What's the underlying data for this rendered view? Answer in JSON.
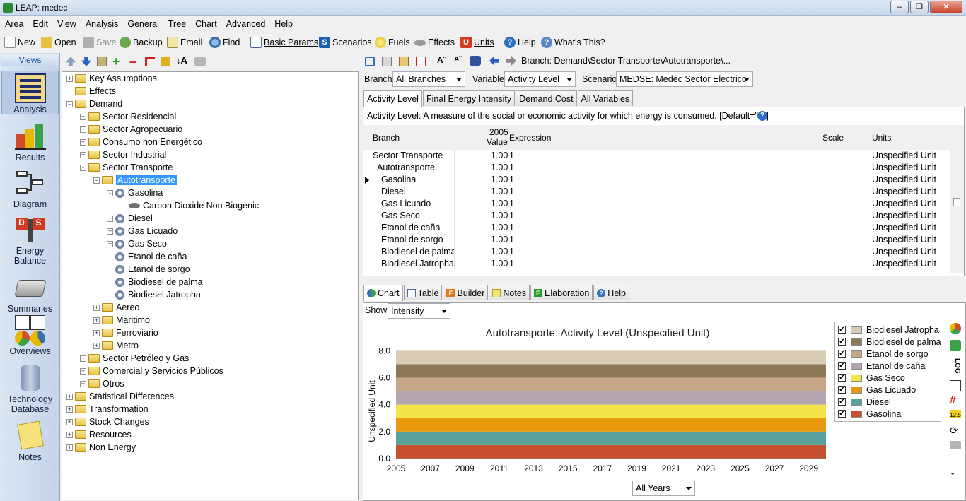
{
  "window": {
    "title": "LEAP: medec"
  },
  "menu": [
    "Area",
    "Edit",
    "View",
    "Analysis",
    "General",
    "Tree",
    "Chart",
    "Advanced",
    "Help"
  ],
  "toolbar": {
    "new": "New",
    "open": "Open",
    "save": "Save",
    "backup": "Backup",
    "email": "Email",
    "find": "Find",
    "basic_params": "Basic Params",
    "scenarios": "Scenarios",
    "fuels": "Fuels",
    "effects": "Effects",
    "units": "Units",
    "help": "Help",
    "whats_this": "What's This?"
  },
  "views": {
    "header": "Views",
    "items": [
      {
        "label": "Analysis",
        "icon": "analysis-icon"
      },
      {
        "label": "Results",
        "icon": "results-icon"
      },
      {
        "label": "Diagram",
        "icon": "diagram-icon"
      },
      {
        "label": "Energy Balance",
        "icon": "energy-balance-icon"
      },
      {
        "label": "Summaries",
        "icon": "summaries-icon"
      },
      {
        "label": "Overviews",
        "icon": "overviews-icon"
      },
      {
        "label": "Technology Database",
        "icon": "technology-database-icon"
      },
      {
        "label": "Notes",
        "icon": "notes-icon"
      }
    ]
  },
  "tree": [
    {
      "label": "Key Assumptions",
      "level": 0,
      "type": "folder",
      "exp": "+"
    },
    {
      "label": "Effects",
      "level": 0,
      "type": "folder",
      "exp": ""
    },
    {
      "label": "Demand",
      "level": 0,
      "type": "folder",
      "exp": "-"
    },
    {
      "label": "Sector Residencial",
      "level": 1,
      "type": "folder",
      "exp": "+"
    },
    {
      "label": "Sector Agropecuario",
      "level": 1,
      "type": "folder",
      "exp": "+"
    },
    {
      "label": "Consumo non Energético",
      "level": 1,
      "type": "folder",
      "exp": "+"
    },
    {
      "label": "Sector Industrial",
      "level": 1,
      "type": "folder",
      "exp": "+"
    },
    {
      "label": "Sector Transporte",
      "level": 1,
      "type": "folder",
      "exp": "-"
    },
    {
      "label": "Autotransporte",
      "level": 2,
      "type": "folder",
      "exp": "-",
      "selected": true
    },
    {
      "label": "Gasolina",
      "level": 3,
      "type": "gear",
      "exp": "-"
    },
    {
      "label": "Carbon Dioxide Non Biogenic",
      "level": 4,
      "type": "leaf",
      "exp": ""
    },
    {
      "label": "Diesel",
      "level": 3,
      "type": "gear",
      "exp": "+"
    },
    {
      "label": "Gas Licuado",
      "level": 3,
      "type": "gear",
      "exp": "+"
    },
    {
      "label": "Gas Seco",
      "level": 3,
      "type": "gear",
      "exp": "+"
    },
    {
      "label": "Etanol de caña",
      "level": 3,
      "type": "gear",
      "exp": ""
    },
    {
      "label": "Etanol de sorgo",
      "level": 3,
      "type": "gear",
      "exp": ""
    },
    {
      "label": "Biodiesel de palma",
      "level": 3,
      "type": "gear",
      "exp": ""
    },
    {
      "label": "Biodiesel Jatropha",
      "level": 3,
      "type": "gear",
      "exp": ""
    },
    {
      "label": "Aereo",
      "level": 2,
      "type": "folder",
      "exp": "+"
    },
    {
      "label": "Maritimo",
      "level": 2,
      "type": "folder",
      "exp": "+"
    },
    {
      "label": "Ferroviario",
      "level": 2,
      "type": "folder",
      "exp": "+"
    },
    {
      "label": "Metro",
      "level": 2,
      "type": "folder",
      "exp": "+"
    },
    {
      "label": "Sector Petróleo y Gas",
      "level": 1,
      "type": "folder",
      "exp": "+"
    },
    {
      "label": "Comercial y Servicios Públicos",
      "level": 1,
      "type": "folder",
      "exp": "+"
    },
    {
      "label": "Otros",
      "level": 1,
      "type": "folder",
      "exp": "+"
    },
    {
      "label": "Statistical Differences",
      "level": 0,
      "type": "folder",
      "exp": "+"
    },
    {
      "label": "Transformation",
      "level": 0,
      "type": "folder",
      "exp": "+"
    },
    {
      "label": "Stock Changes",
      "level": 0,
      "type": "folder",
      "exp": "+"
    },
    {
      "label": "Resources",
      "level": 0,
      "type": "folder",
      "exp": "+"
    },
    {
      "label": "Non Energy",
      "level": 0,
      "type": "folder",
      "exp": "+"
    }
  ],
  "breadcrumb": "Branch: Demand\\Sector Transporte\\Autotransporte\\...",
  "selectors": {
    "branch_label": "Branch:",
    "branch_value": "All Branches",
    "variable_label": "Variable:",
    "variable_value": "Activity Level",
    "scenario_label": "Scenario:",
    "scenario_value": "MEDSE: Medec Sector Electrico"
  },
  "var_tabs": [
    "Activity Level",
    "Final Energy Intensity",
    "Demand Cost",
    "All Variables"
  ],
  "description": "Activity Level: A measure of the social or economic activity for which energy is consumed. [Default=\"0\"]",
  "grid": {
    "headers": {
      "branch": "Branch",
      "value_year": "2005",
      "value_label": "Value",
      "expression": "Expression",
      "scale": "Scale",
      "units": "Units"
    },
    "rows": [
      {
        "branch": "Sector Transporte",
        "indent": 0,
        "value": "1.00",
        "expr": "1",
        "units": "Unspecified Unit"
      },
      {
        "branch": "Autotransporte",
        "indent": 1,
        "value": "1.00",
        "expr": "1",
        "units": "Unspecified Unit"
      },
      {
        "branch": "Gasolina",
        "indent": 2,
        "value": "1.00",
        "expr": "1",
        "units": "Unspecified Unit",
        "current": true
      },
      {
        "branch": "Diesel",
        "indent": 2,
        "value": "1.00",
        "expr": "1",
        "units": "Unspecified Unit"
      },
      {
        "branch": "Gas Licuado",
        "indent": 2,
        "value": "1.00",
        "expr": "1",
        "units": "Unspecified Unit"
      },
      {
        "branch": "Gas Seco",
        "indent": 2,
        "value": "1.00",
        "expr": "1",
        "units": "Unspecified Unit"
      },
      {
        "branch": "Etanol de caña",
        "indent": 2,
        "value": "1.00",
        "expr": "1",
        "units": "Unspecified Unit"
      },
      {
        "branch": "Etanol de sorgo",
        "indent": 2,
        "value": "1.00",
        "expr": "1",
        "units": "Unspecified Unit"
      },
      {
        "branch": "Biodiesel de palma",
        "indent": 2,
        "value": "1.00",
        "expr": "1",
        "units": "Unspecified Unit"
      },
      {
        "branch": "Biodiesel Jatropha",
        "indent": 2,
        "value": "1.00",
        "expr": "1",
        "units": "Unspecified Unit"
      }
    ]
  },
  "lower_tabs": [
    "Chart",
    "Table",
    "Builder",
    "Notes",
    "Elaboration",
    "Help"
  ],
  "show": {
    "label": "Show:",
    "value": "Intensity"
  },
  "years_select": "All Years",
  "chart_data": {
    "type": "area",
    "stacked": true,
    "title": "Autotransporte: Activity Level (Unspecified Unit)",
    "ylabel": "Unspecified Unit",
    "ylim": [
      0,
      8.8
    ],
    "yticks": [
      "0.0",
      "2.0",
      "4.0",
      "6.0",
      "8.0"
    ],
    "x": [
      "2005",
      "2007",
      "2009",
      "2011",
      "2013",
      "2015",
      "2017",
      "2019",
      "2021",
      "2023",
      "2025",
      "2027",
      "2029"
    ],
    "legend_position": "right",
    "series": [
      {
        "name": "Gasolina",
        "color": "#c6502f",
        "value": 1.0
      },
      {
        "name": "Diesel",
        "color": "#58a29b",
        "value": 1.0
      },
      {
        "name": "Gas Licuado",
        "color": "#e79a0d",
        "value": 1.0
      },
      {
        "name": "Gas Seco",
        "color": "#f4e54c",
        "value": 1.0
      },
      {
        "name": "Etanol de caña",
        "color": "#b3a6b1",
        "value": 1.0
      },
      {
        "name": "Etanol de sorgo",
        "color": "#c6a889",
        "value": 1.0
      },
      {
        "name": "Biodiesel de palma",
        "color": "#8c7757",
        "value": 1.0
      },
      {
        "name": "Biodiesel Jatropha",
        "color": "#d8ccb6",
        "value": 1.0
      }
    ]
  }
}
